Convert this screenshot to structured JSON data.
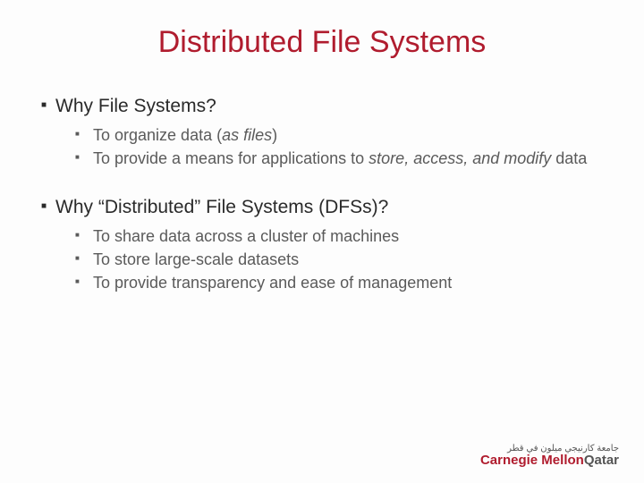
{
  "title": "Distributed File Systems",
  "sections": [
    {
      "heading": "Why File Systems?",
      "items": [
        {
          "pre": "To organize data (",
          "em": "as files",
          "post": ")"
        },
        {
          "pre": "To provide a means for applications to ",
          "em": "store, access, and modify",
          "post": " data"
        }
      ]
    },
    {
      "heading": "Why “Distributed” File Systems (DFSs)?",
      "items": [
        {
          "pre": "To share data across a cluster of machines",
          "em": "",
          "post": ""
        },
        {
          "pre": "To store large-scale datasets",
          "em": "",
          "post": ""
        },
        {
          "pre": "To provide transparency and ease of management",
          "em": "",
          "post": ""
        }
      ]
    }
  ],
  "logo": {
    "arabic": "جامعة كارنيجي ميلون في قطر",
    "main1": "Carnegie Mellon",
    "main2": "Qatar"
  }
}
